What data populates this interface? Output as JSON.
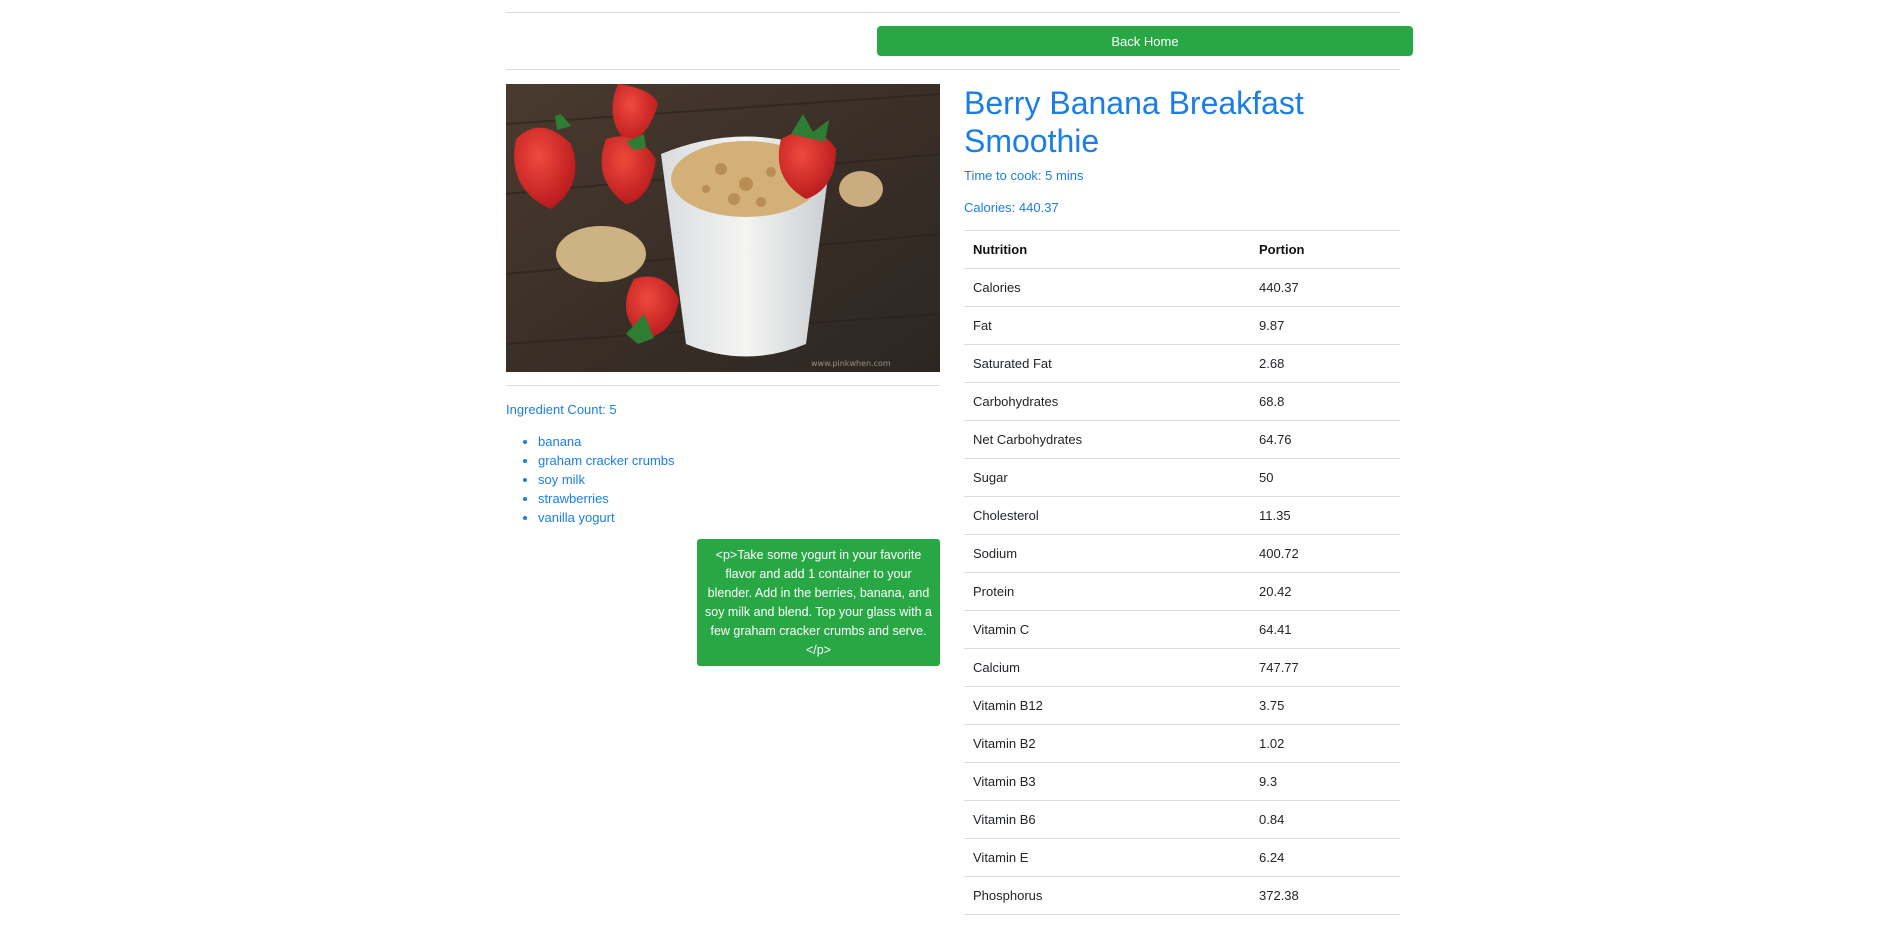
{
  "header": {
    "back_label": "Back Home"
  },
  "recipe": {
    "title": "Berry Banana Breakfast Smoothie",
    "time_to_cook": "Time to cook: 5 mins",
    "calories": "Calories: 440.37",
    "image_alt": "smoothie-photo",
    "ingredient_count": "Ingredient Count: 5",
    "ingredients": [
      "banana",
      "graham cracker crumbs",
      "soy milk",
      "strawberries",
      "vanilla yogurt"
    ],
    "instructions": "<p>Take some yogurt in your favorite flavor and add 1 container to your blender. Add in the berries, banana, and soy milk and blend. Top your glass with a few graham cracker crumbs and serve.</p>"
  },
  "nutrition": {
    "headers": [
      "Nutrition",
      "Portion"
    ],
    "rows": [
      [
        "Calories",
        "440.37"
      ],
      [
        "Fat",
        "9.87"
      ],
      [
        "Saturated Fat",
        "2.68"
      ],
      [
        "Carbohydrates",
        "68.8"
      ],
      [
        "Net Carbohydrates",
        "64.76"
      ],
      [
        "Sugar",
        "50"
      ],
      [
        "Cholesterol",
        "11.35"
      ],
      [
        "Sodium",
        "400.72"
      ],
      [
        "Protein",
        "20.42"
      ],
      [
        "Vitamin C",
        "64.41"
      ],
      [
        "Calcium",
        "747.77"
      ],
      [
        "Vitamin B12",
        "3.75"
      ],
      [
        "Vitamin B2",
        "1.02"
      ],
      [
        "Vitamin B3",
        "9.3"
      ],
      [
        "Vitamin B6",
        "0.84"
      ],
      [
        "Vitamin E",
        "6.24"
      ],
      [
        "Phosphorus",
        "372.38"
      ]
    ]
  },
  "colors": {
    "accent_blue": "#1b7ee6",
    "button_green": "#28a745"
  }
}
